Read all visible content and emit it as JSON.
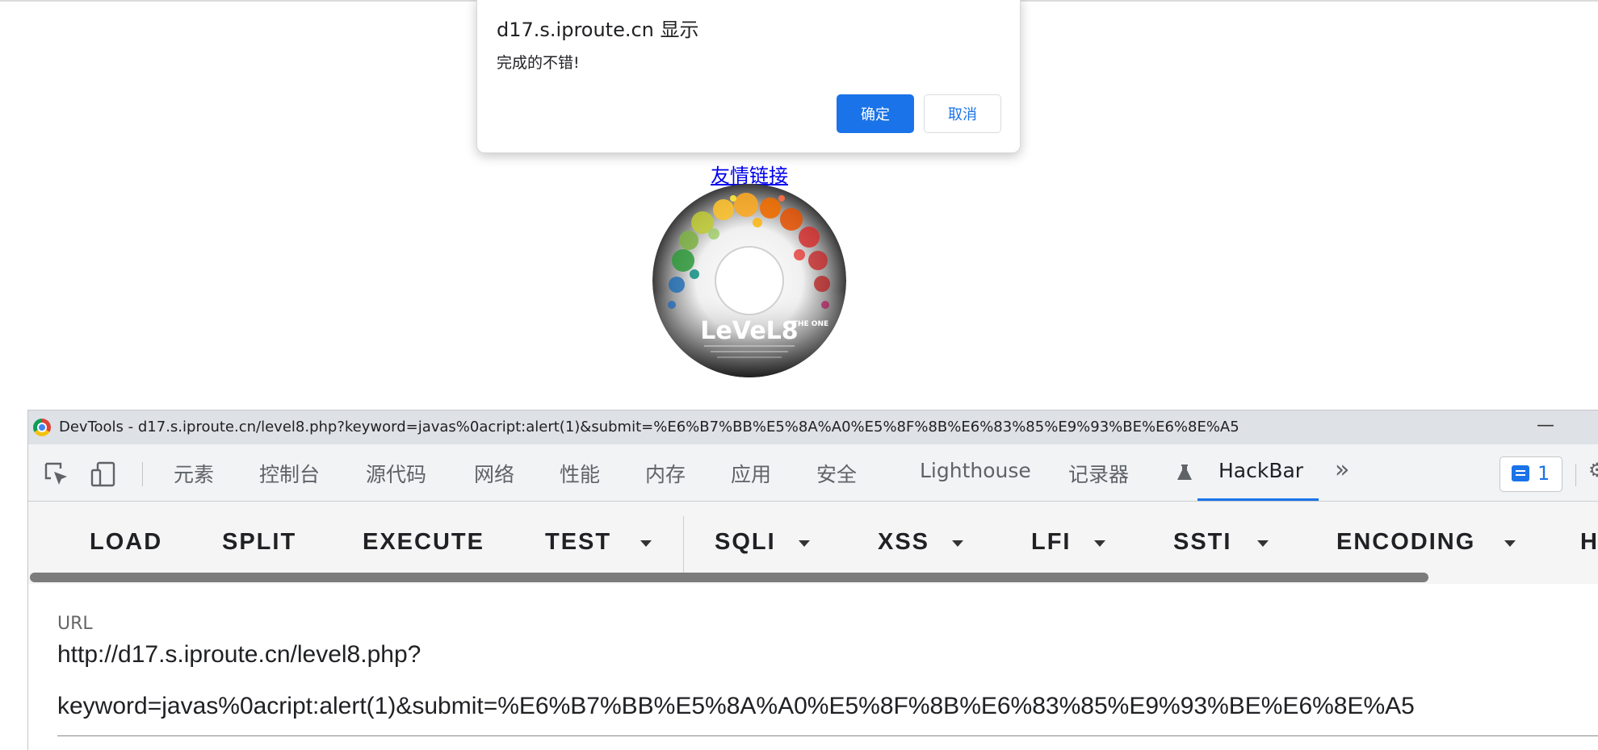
{
  "dialog": {
    "title": "d17.s.iproute.cn 显示",
    "message": "完成的不错!",
    "ok_label": "确定",
    "cancel_label": "取消"
  },
  "page": {
    "friend_link": "友情链接",
    "disc_text": "LeVeL8",
    "disc_subtext": "THE ONE"
  },
  "devtools": {
    "title": "DevTools - d17.s.iproute.cn/level8.php?keyword=javas%0acript:alert(1)&submit=%E6%B7%BB%E5%8A%A0%E5%8F%8B%E6%83%85%E9%93%BE%E6%8E%A5",
    "tabs": [
      "元素",
      "控制台",
      "源代码",
      "网络",
      "性能",
      "内存",
      "应用",
      "安全",
      "Lighthouse",
      "记录器",
      "HackBar"
    ],
    "active_tab": "HackBar",
    "issues_count": "1"
  },
  "hackbar": {
    "buttons": [
      "LOAD",
      "SPLIT",
      "EXECUTE",
      "TEST",
      "SQLI",
      "XSS",
      "LFI",
      "SSTI",
      "ENCODING",
      "H"
    ],
    "url_label": "URL",
    "url_line1": "http://d17.s.iproute.cn/level8.php?",
    "url_line2": "keyword=javas%0acript:alert(1)&submit=%E6%B7%BB%E5%8A%A0%E5%8F%8B%E6%83%85%E9%93%BE%E6%8E%A5"
  },
  "colors": {
    "accent": "#1a73e8",
    "link": "#0000ee"
  }
}
